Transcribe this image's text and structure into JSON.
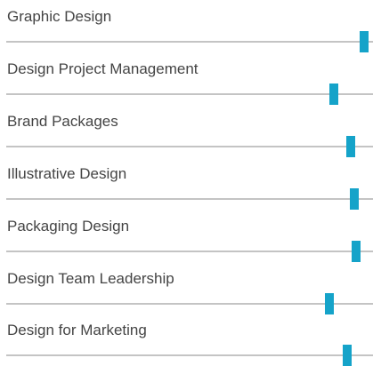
{
  "colors": {
    "marker": "#15a3c9",
    "track": "#c4c4c4",
    "label": "#444444"
  },
  "skills": [
    {
      "label": "Graphic Design",
      "level": 0.975
    },
    {
      "label": "Design Project Management",
      "level": 0.892
    },
    {
      "label": "Brand Packages",
      "level": 0.94
    },
    {
      "label": "Illustrative Design",
      "level": 0.95
    },
    {
      "label": "Packaging Design",
      "level": 0.953
    },
    {
      "label": "Design Team Leadership",
      "level": 0.882
    },
    {
      "label": "Design for Marketing",
      "level": 0.929
    }
  ]
}
